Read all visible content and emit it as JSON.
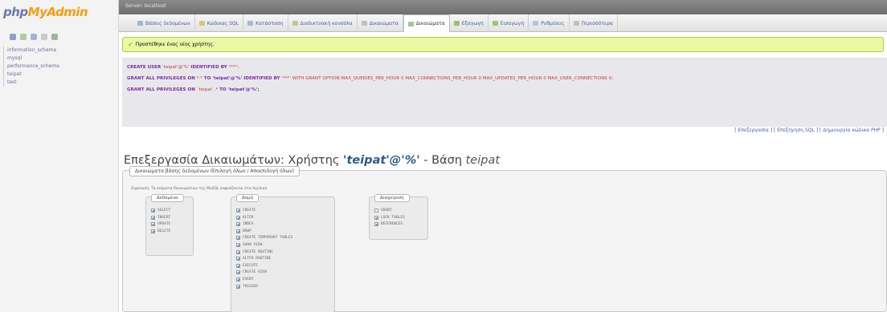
{
  "nav": {
    "logo": {
      "php": "php",
      "my": "My",
      "admin": "Admin"
    },
    "databases": [
      "information_schema",
      "mysql",
      "performance_schema",
      "teipat",
      "test"
    ]
  },
  "serverbar": {
    "crumb": "Server: localhost"
  },
  "tabs": [
    {
      "label": "Βάσεις δεδομένων",
      "icon": "database-icon",
      "active": false
    },
    {
      "label": "Κώδικας SQL",
      "icon": "sql-icon",
      "active": false
    },
    {
      "label": "Κατάσταση",
      "icon": "status-icon",
      "active": false
    },
    {
      "label": "Διαδικτυακή κονσόλα",
      "icon": "console-icon",
      "active": false
    },
    {
      "label": "Δικαιώματα",
      "icon": "users-icon",
      "active": false
    },
    {
      "label": "Δικαιώματα",
      "icon": "privileges-icon",
      "active": true
    },
    {
      "label": "Εξαγωγή",
      "icon": "export-icon",
      "active": false
    },
    {
      "label": "Εισαγωγή",
      "icon": "import-icon",
      "active": false
    },
    {
      "label": "Ρυθμίσεις",
      "icon": "settings-icon",
      "active": false
    },
    {
      "label": "Περισσότερα",
      "icon": "more-icon",
      "active": false
    }
  ],
  "success": {
    "text": "Προστέθηκε ένας νέος χρήστης."
  },
  "sql": {
    "line1": {
      "kw": "CREATE USER",
      "str": " 'teipat'@'%' ",
      "kw2": "IDENTIFIED BY",
      "rest": " '***';"
    },
    "line2": {
      "kw": "GRANT ALL PRIVILEGES ON",
      "str": " *.* ",
      "kw2": "TO 'teipat'@'%' IDENTIFIED BY",
      "rest": " '***' WITH GRANT OPTION MAX_QUERIES_PER_HOUR 0 MAX_CONNECTIONS_PER_HOUR 0 MAX_UPDATES_PER_HOUR 0 MAX_USER_CONNECTIONS 0;"
    },
    "line3": {
      "kw": "GRANT ALL PRIVILEGES ON",
      "str": " `teipat`.* ",
      "kw2": "TO 'teipat'@'%';",
      "rest": ""
    },
    "links": "[ Επεξεργασία ] [ Επεξήγηση SQL ] [ Δημιουργία κώδικα PHP ]"
  },
  "heading": {
    "prefix": "Επεξεργασία Δικαιωμάτων: Χρήστης ",
    "user": "'teipat'@'%'",
    "mid": " - Βάση ",
    "db": "teipat"
  },
  "fieldset": {
    "legend": "Δικαιώματα βάσης δεδομένων (Επιλογή όλων / Αποεπιλογή όλων)",
    "note": "Σημείωση: Τα ονόματα δικαιωμάτων της MySQL εκφράζονται στα Αγγλικά",
    "groups": [
      {
        "title": "Δεδομένα",
        "items": [
          {
            "label": "SELECT",
            "checked": true
          },
          {
            "label": "INSERT",
            "checked": true
          },
          {
            "label": "UPDATE",
            "checked": true
          },
          {
            "label": "DELETE",
            "checked": true
          }
        ]
      },
      {
        "title": "Δομή",
        "items": [
          {
            "label": "CREATE",
            "checked": true
          },
          {
            "label": "ALTER",
            "checked": true
          },
          {
            "label": "INDEX",
            "checked": true
          },
          {
            "label": "DROP",
            "checked": true
          },
          {
            "label": "CREATE TEMPORARY TABLES",
            "checked": true
          },
          {
            "label": "SHOW VIEW",
            "checked": true
          },
          {
            "label": "CREATE ROUTINE",
            "checked": true
          },
          {
            "label": "ALTER ROUTINE",
            "checked": true
          },
          {
            "label": "EXECUTE",
            "checked": true
          },
          {
            "label": "CREATE VIEW",
            "checked": true
          },
          {
            "label": "EVENT",
            "checked": true
          },
          {
            "label": "TRIGGER",
            "checked": true
          }
        ]
      },
      {
        "title": "Διαχείριση",
        "items": [
          {
            "label": "GRANT",
            "checked": false
          },
          {
            "label": "LOCK TABLES",
            "checked": true
          },
          {
            "label": "REFERENCES",
            "checked": true
          }
        ]
      }
    ]
  },
  "colors": {
    "tabLink": "#4b5aa0",
    "success_bg": "#ebf8a4",
    "success_border": "#a2d246"
  }
}
